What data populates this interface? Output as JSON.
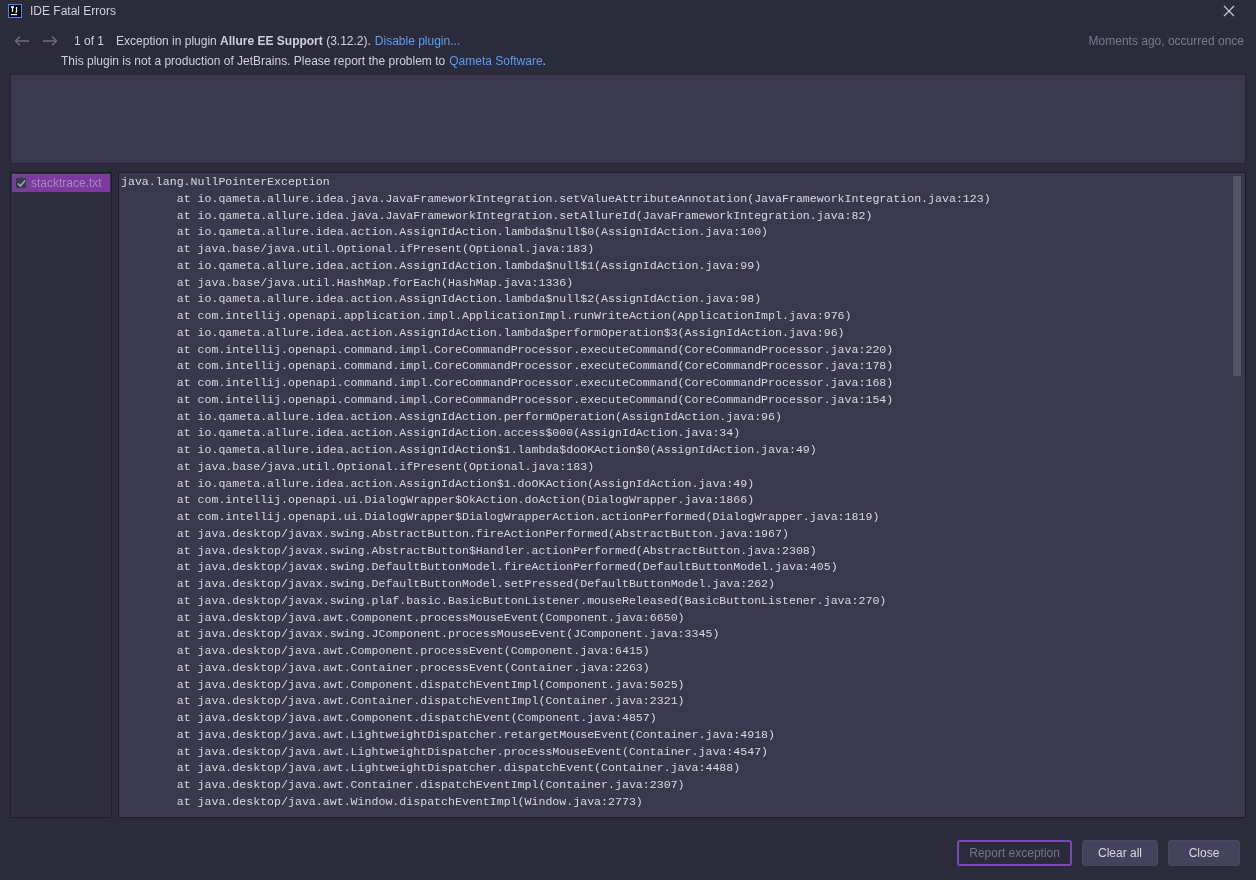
{
  "window": {
    "title": "IDE Fatal Errors"
  },
  "header": {
    "counter": "1 of 1",
    "message": "Exception in plugin **Allure EE Support** (3.12.2).",
    "disable_link": "Disable plugin...",
    "time": "Moments ago, occurred once",
    "notice": "This plugin is not a production of JetBrains. Please report the problem to",
    "vendor_link": "Qameta Software",
    "notice_end": "."
  },
  "attachments": [
    {
      "name": "stacktrace.txt",
      "checked": true,
      "selected": true
    }
  ],
  "stacktrace": [
    "java.lang.NullPointerException",
    "\tat io.qameta.allure.idea.java.JavaFrameworkIntegration.setValueAttributeAnnotation(JavaFrameworkIntegration.java:123)",
    "\tat io.qameta.allure.idea.java.JavaFrameworkIntegration.setAllureId(JavaFrameworkIntegration.java:82)",
    "\tat io.qameta.allure.idea.action.AssignIdAction.lambda$null$0(AssignIdAction.java:100)",
    "\tat java.base/java.util.Optional.ifPresent(Optional.java:183)",
    "\tat io.qameta.allure.idea.action.AssignIdAction.lambda$null$1(AssignIdAction.java:99)",
    "\tat java.base/java.util.HashMap.forEach(HashMap.java:1336)",
    "\tat io.qameta.allure.idea.action.AssignIdAction.lambda$null$2(AssignIdAction.java:98)",
    "\tat com.intellij.openapi.application.impl.ApplicationImpl.runWriteAction(ApplicationImpl.java:976)",
    "\tat io.qameta.allure.idea.action.AssignIdAction.lambda$performOperation$3(AssignIdAction.java:96)",
    "\tat com.intellij.openapi.command.impl.CoreCommandProcessor.executeCommand(CoreCommandProcessor.java:220)",
    "\tat com.intellij.openapi.command.impl.CoreCommandProcessor.executeCommand(CoreCommandProcessor.java:178)",
    "\tat com.intellij.openapi.command.impl.CoreCommandProcessor.executeCommand(CoreCommandProcessor.java:168)",
    "\tat com.intellij.openapi.command.impl.CoreCommandProcessor.executeCommand(CoreCommandProcessor.java:154)",
    "\tat io.qameta.allure.idea.action.AssignIdAction.performOperation(AssignIdAction.java:96)",
    "\tat io.qameta.allure.idea.action.AssignIdAction.access$000(AssignIdAction.java:34)",
    "\tat io.qameta.allure.idea.action.AssignIdAction$1.lambda$doOKAction$0(AssignIdAction.java:49)",
    "\tat java.base/java.util.Optional.ifPresent(Optional.java:183)",
    "\tat io.qameta.allure.idea.action.AssignIdAction$1.doOKAction(AssignIdAction.java:49)",
    "\tat com.intellij.openapi.ui.DialogWrapper$OkAction.doAction(DialogWrapper.java:1866)",
    "\tat com.intellij.openapi.ui.DialogWrapper$DialogWrapperAction.actionPerformed(DialogWrapper.java:1819)",
    "\tat java.desktop/javax.swing.AbstractButton.fireActionPerformed(AbstractButton.java:1967)",
    "\tat java.desktop/javax.swing.AbstractButton$Handler.actionPerformed(AbstractButton.java:2308)",
    "\tat java.desktop/javax.swing.DefaultButtonModel.fireActionPerformed(DefaultButtonModel.java:405)",
    "\tat java.desktop/javax.swing.DefaultButtonModel.setPressed(DefaultButtonModel.java:262)",
    "\tat java.desktop/javax.swing.plaf.basic.BasicButtonListener.mouseReleased(BasicButtonListener.java:270)",
    "\tat java.desktop/java.awt.Component.processMouseEvent(Component.java:6650)",
    "\tat java.desktop/javax.swing.JComponent.processMouseEvent(JComponent.java:3345)",
    "\tat java.desktop/java.awt.Component.processEvent(Component.java:6415)",
    "\tat java.desktop/java.awt.Container.processEvent(Container.java:2263)",
    "\tat java.desktop/java.awt.Component.dispatchEventImpl(Component.java:5025)",
    "\tat java.desktop/java.awt.Container.dispatchEventImpl(Container.java:2321)",
    "\tat java.desktop/java.awt.Component.dispatchEvent(Component.java:4857)",
    "\tat java.desktop/java.awt.LightweightDispatcher.retargetMouseEvent(Container.java:4918)",
    "\tat java.desktop/java.awt.LightweightDispatcher.processMouseEvent(Container.java:4547)",
    "\tat java.desktop/java.awt.LightweightDispatcher.dispatchEvent(Container.java:4488)",
    "\tat java.desktop/java.awt.Container.dispatchEventImpl(Container.java:2307)",
    "\tat java.desktop/java.awt.Window.dispatchEventImpl(Window.java:2773)"
  ],
  "buttons": [
    {
      "label": "Report exception",
      "disabled": true,
      "focused": true
    },
    {
      "label": "Clear all",
      "disabled": false,
      "focused": false
    },
    {
      "label": "Close",
      "disabled": false,
      "focused": false
    }
  ]
}
